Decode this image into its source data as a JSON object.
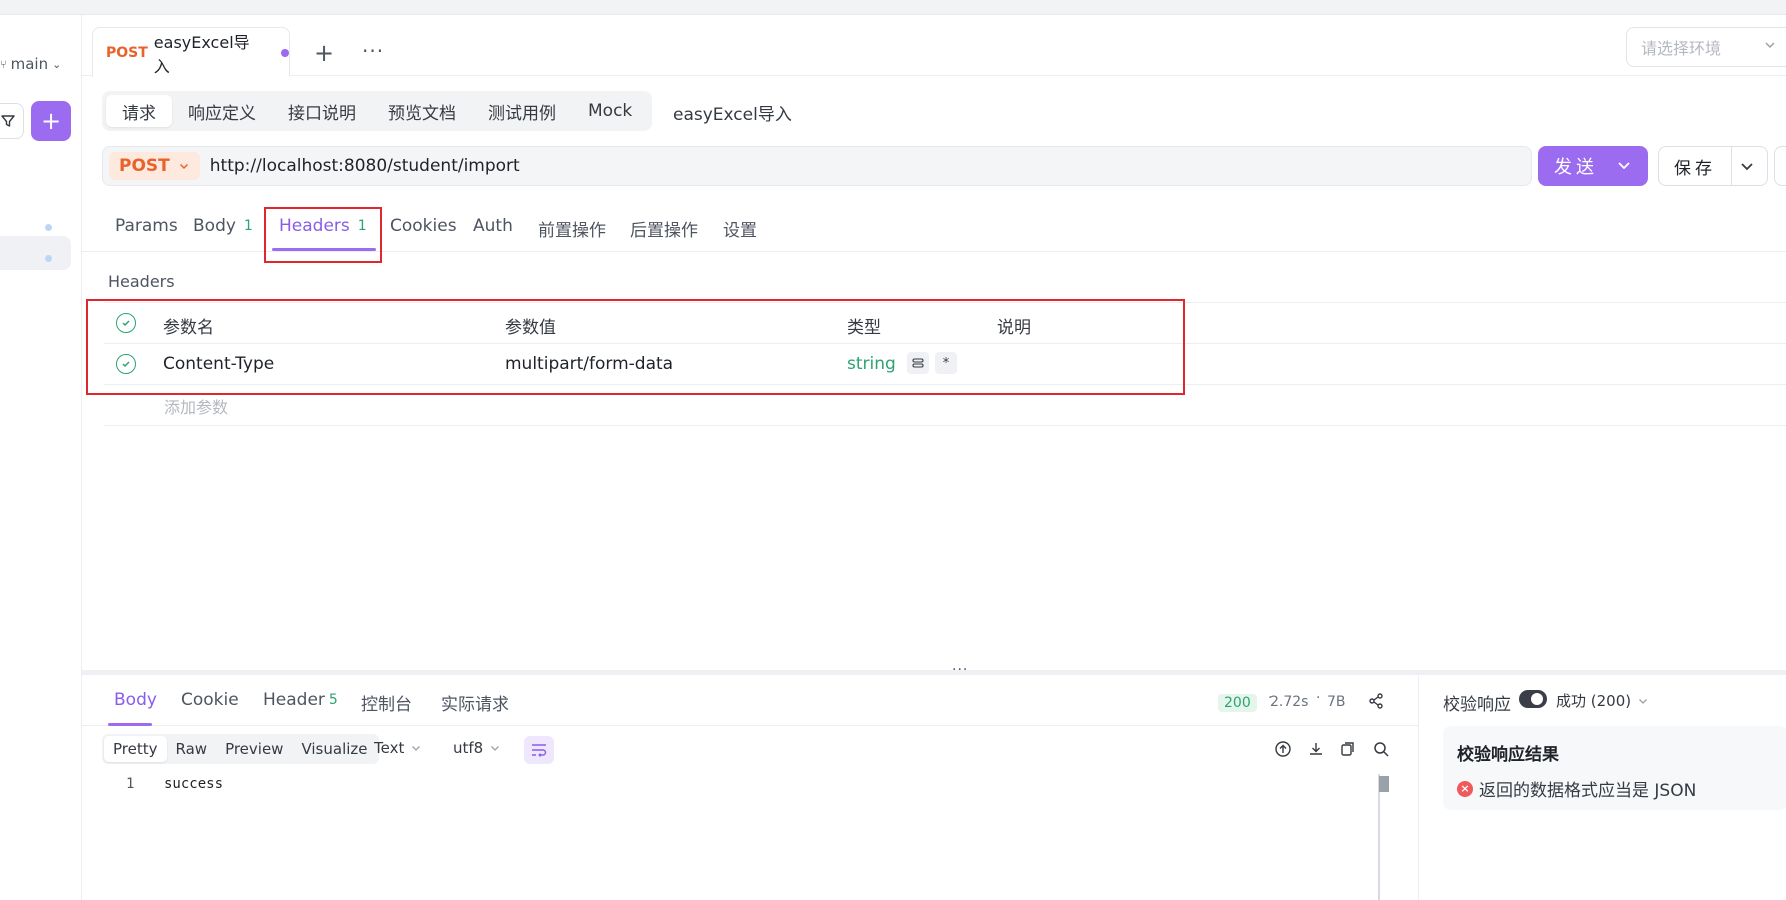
{
  "sidebar": {
    "branch": "main"
  },
  "tab": {
    "method": "POST",
    "title": "easyExcel导入"
  },
  "env": {
    "placeholder": "请选择环境"
  },
  "subtabs": [
    "请求",
    "响应定义",
    "接口说明",
    "预览文档",
    "测试用例",
    "Mock"
  ],
  "api_name": "easyExcel导入",
  "request": {
    "method": "POST",
    "url": "http://localhost:8080/student/import",
    "send_label": "发送",
    "save_label": "保存"
  },
  "req_tabs": {
    "params": "Params",
    "body": "Body",
    "body_count": "1",
    "headers": "Headers",
    "headers_count": "1",
    "cookies": "Cookies",
    "auth": "Auth",
    "pre": "前置操作",
    "post": "后置操作",
    "settings": "设置"
  },
  "headers_section": {
    "label": "Headers",
    "columns": {
      "name": "参数名",
      "value": "参数值",
      "type": "类型",
      "desc": "说明"
    },
    "rows": [
      {
        "name": "Content-Type",
        "value": "multipart/form-data",
        "type": "string",
        "required": "*"
      }
    ],
    "add_placeholder": "添加参数"
  },
  "response": {
    "tabs": {
      "body": "Body",
      "cookie": "Cookie",
      "header": "Header",
      "header_count": "5",
      "console": "控制台",
      "actual": "实际请求"
    },
    "status_code": "200",
    "time": "2.72s",
    "size": "7B",
    "formats": [
      "Pretty",
      "Raw",
      "Preview",
      "Visualize"
    ],
    "content_type": "Text",
    "encoding": "utf8",
    "line_no": "1",
    "content": "success"
  },
  "validation": {
    "label": "校验响应",
    "status": "成功 (200)",
    "result_title": "校验响应结果",
    "result_msg": "返回的数据格式应当是 JSON"
  },
  "colors": {
    "accent": "#9c6cf0",
    "method": "#e8622c",
    "success": "#2ba471",
    "highlight_box": "#e0262f"
  }
}
